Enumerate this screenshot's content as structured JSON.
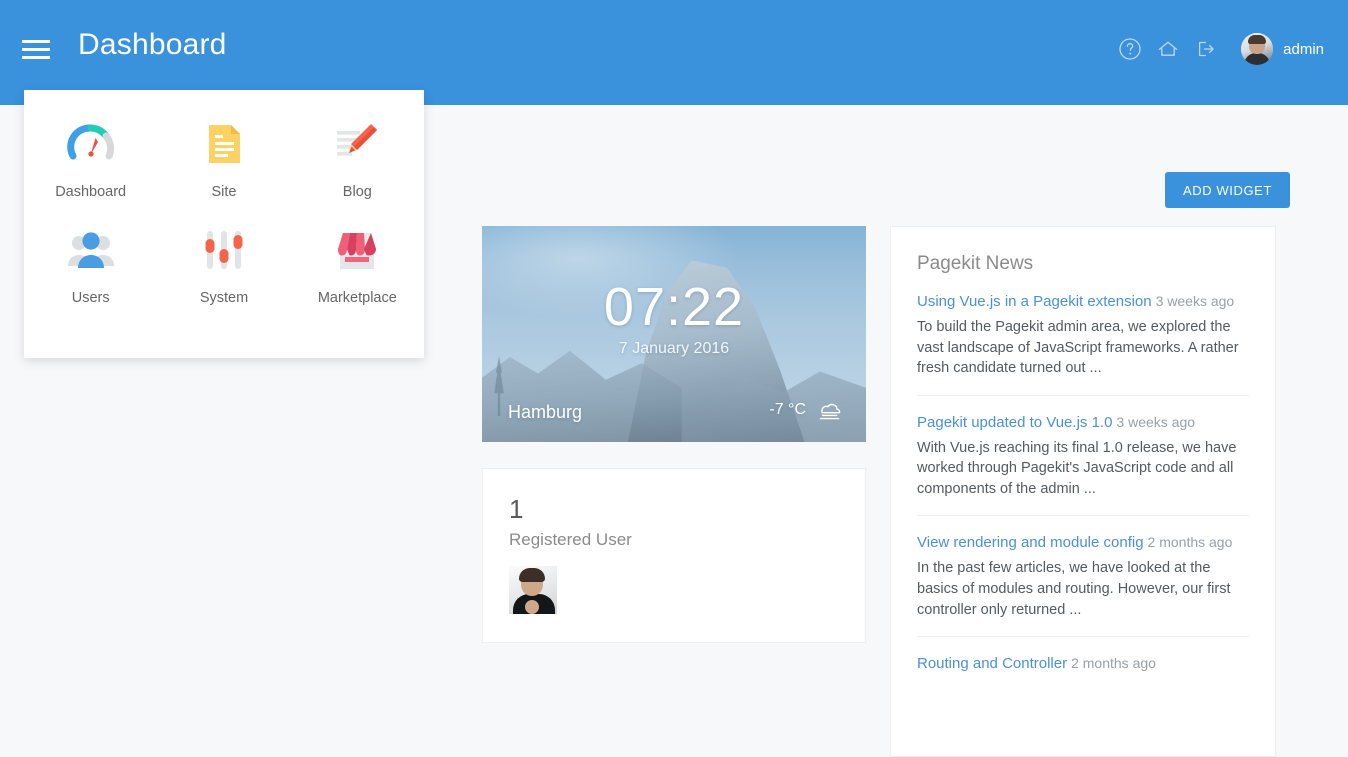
{
  "header": {
    "title": "Dashboard",
    "menu_icon": "hamburger-icon",
    "icons": [
      {
        "name": "help-icon",
        "glyph": "?"
      },
      {
        "name": "home-icon",
        "glyph": "home"
      },
      {
        "name": "logout-icon",
        "glyph": "logout"
      }
    ],
    "user": {
      "name": "admin",
      "avatar": "user-avatar"
    },
    "accent_color": "#3a91dc"
  },
  "dropdown": {
    "items": [
      {
        "label": "Dashboard",
        "icon": "gauge-icon"
      },
      {
        "label": "Site",
        "icon": "document-icon"
      },
      {
        "label": "Blog",
        "icon": "pencil-icon"
      },
      {
        "label": "Users",
        "icon": "users-icon"
      },
      {
        "label": "System",
        "icon": "sliders-icon"
      },
      {
        "label": "Marketplace",
        "icon": "shop-icon"
      }
    ]
  },
  "toolbar": {
    "add_widget_label": "ADD WIDGET"
  },
  "weather": {
    "time": "07:22",
    "date": "7 January 2016",
    "city": "Hamburg",
    "temperature": "-7 °C",
    "condition_icon": "cloud-fog-icon"
  },
  "users_widget": {
    "count": "1",
    "label": "Registered User"
  },
  "news": {
    "title": "Pagekit News",
    "items": [
      {
        "title": "Using Vue.js in a Pagekit extension",
        "date": "3 weeks ago",
        "excerpt": "To build the Pagekit admin area, we explored the vast landscape of JavaScript frameworks. A rather fresh candidate turned out ..."
      },
      {
        "title": "Pagekit updated to Vue.js 1.0",
        "date": "3 weeks ago",
        "excerpt": "With Vue.js reaching its final 1.0 release, we have worked through Pagekit's JavaScript code and all components of the admin ..."
      },
      {
        "title": "View rendering and module config",
        "date": "2 months ago",
        "excerpt": "In the past few articles, we have looked at the basics of modules and routing. However, our first controller only returned ..."
      },
      {
        "title": "Routing and Controller",
        "date": "2 months ago",
        "excerpt": ""
      }
    ]
  },
  "colors": {
    "accent": "#3a91dc",
    "link": "#4a90d9",
    "page_bg": "#f7f8f9"
  }
}
